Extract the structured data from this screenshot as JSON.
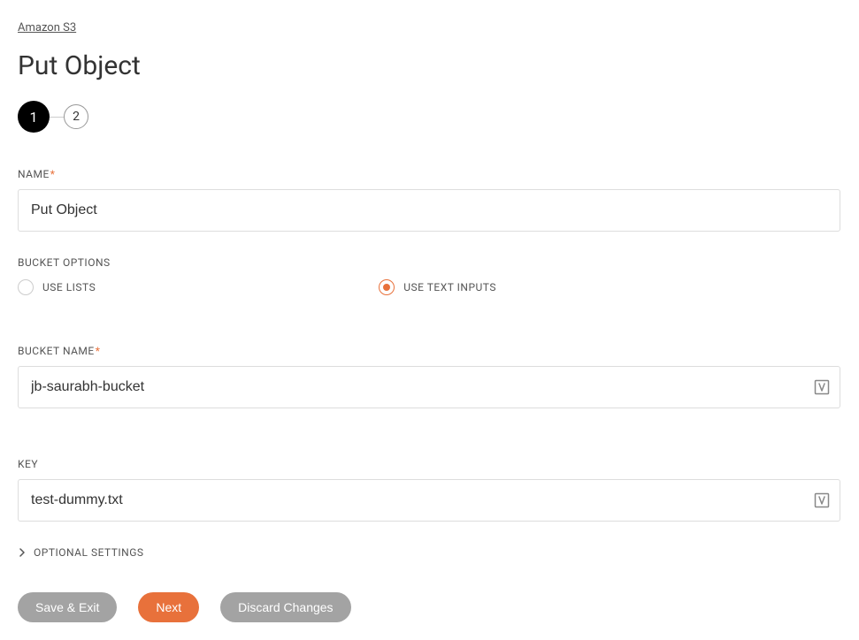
{
  "breadcrumb": "Amazon S3",
  "page_title": "Put Object",
  "stepper": {
    "step1": "1",
    "step2": "2"
  },
  "name_field": {
    "label": "NAME",
    "value": "Put Object"
  },
  "bucket_options": {
    "label": "BUCKET OPTIONS",
    "option_lists": "USE LISTS",
    "option_text": "USE TEXT INPUTS",
    "selected": "text"
  },
  "bucket_name_field": {
    "label": "BUCKET NAME",
    "value": "jb-saurabh-bucket"
  },
  "key_field": {
    "label": "KEY",
    "value": "test-dummy.txt"
  },
  "optional_settings_label": "OPTIONAL SETTINGS",
  "buttons": {
    "save_exit": "Save & Exit",
    "next": "Next",
    "discard": "Discard Changes"
  }
}
